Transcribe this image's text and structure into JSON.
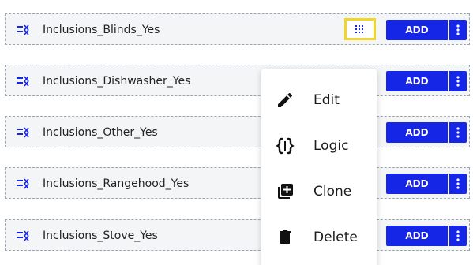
{
  "rows": [
    {
      "label": "Inclusions_Blinds_Yes",
      "add_label": "ADD"
    },
    {
      "label": "Inclusions_Dishwasher_Yes",
      "add_label": "ADD"
    },
    {
      "label": "Inclusions_Other_Yes",
      "add_label": "ADD"
    },
    {
      "label": "Inclusions_Rangehood_Yes",
      "add_label": "ADD"
    },
    {
      "label": "Inclusions_Stove_Yes",
      "add_label": "ADD"
    }
  ],
  "menu": {
    "items": [
      {
        "label": "Edit",
        "icon": "pencil-icon"
      },
      {
        "label": "Logic",
        "icon": "braces-icon"
      },
      {
        "label": "Clone",
        "icon": "clone-icon"
      },
      {
        "label": "Delete",
        "icon": "trash-icon"
      }
    ]
  },
  "colors": {
    "accent": "#1526e6",
    "highlight": "#f2d52a",
    "row_bg": "#f4f5f7"
  }
}
